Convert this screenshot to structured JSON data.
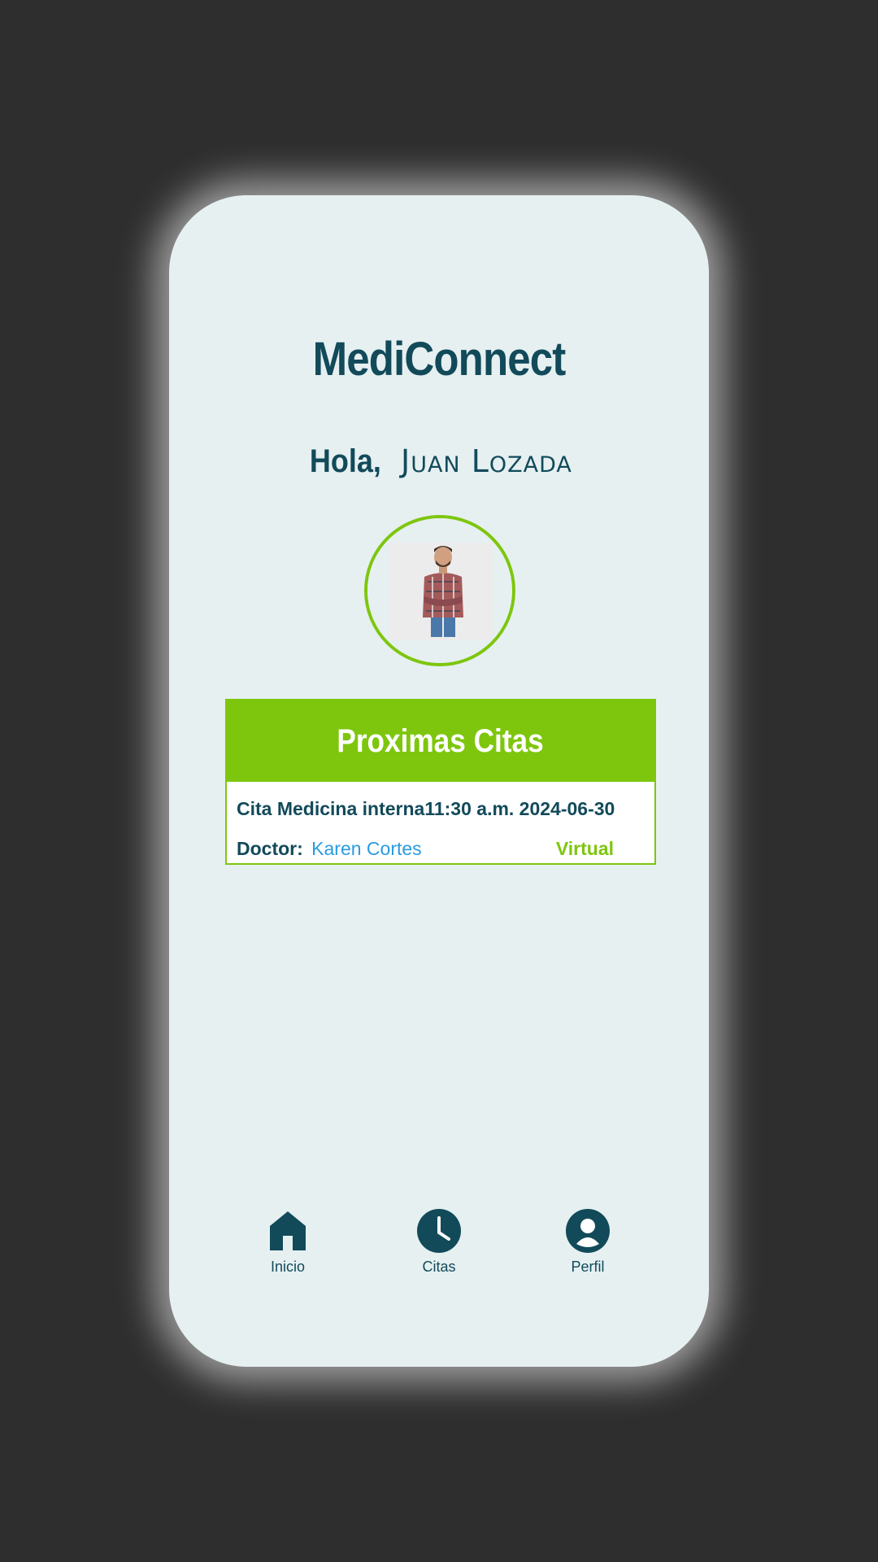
{
  "app": {
    "title": "MediConnect"
  },
  "greeting": {
    "prefix": "Hola,",
    "user_name": "Juan Lozada"
  },
  "appointments": {
    "header": "Proximas Citas",
    "items": [
      {
        "summary": "Cita Medicina interna11:30 a.m. 2024-06-30",
        "doctor_label": "Doctor:",
        "doctor_name": "Karen Cortes",
        "modality": "Virtual"
      }
    ]
  },
  "bottom_nav": {
    "items": [
      {
        "label": "Inicio",
        "icon": "home-icon"
      },
      {
        "label": "Citas",
        "icon": "clock-icon"
      },
      {
        "label": "Perfil",
        "icon": "user-circle-icon"
      }
    ]
  },
  "colors": {
    "primary": "#124a5a",
    "accent": "#7ec60e",
    "link": "#2a9be0",
    "background": "#e6f0f1"
  }
}
